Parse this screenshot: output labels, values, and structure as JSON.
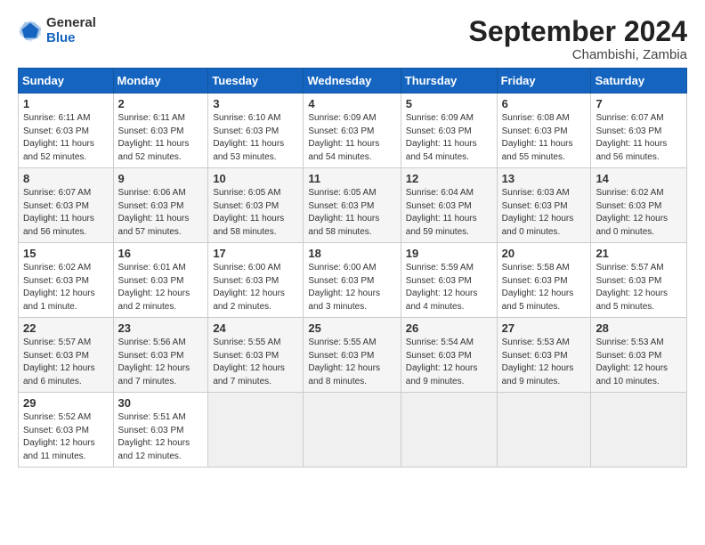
{
  "header": {
    "logo_general": "General",
    "logo_blue": "Blue",
    "month_title": "September 2024",
    "subtitle": "Chambishi, Zambia"
  },
  "weekdays": [
    "Sunday",
    "Monday",
    "Tuesday",
    "Wednesday",
    "Thursday",
    "Friday",
    "Saturday"
  ],
  "weeks": [
    [
      {
        "day": "1",
        "info": "Sunrise: 6:11 AM\nSunset: 6:03 PM\nDaylight: 11 hours\nand 52 minutes."
      },
      {
        "day": "2",
        "info": "Sunrise: 6:11 AM\nSunset: 6:03 PM\nDaylight: 11 hours\nand 52 minutes."
      },
      {
        "day": "3",
        "info": "Sunrise: 6:10 AM\nSunset: 6:03 PM\nDaylight: 11 hours\nand 53 minutes."
      },
      {
        "day": "4",
        "info": "Sunrise: 6:09 AM\nSunset: 6:03 PM\nDaylight: 11 hours\nand 54 minutes."
      },
      {
        "day": "5",
        "info": "Sunrise: 6:09 AM\nSunset: 6:03 PM\nDaylight: 11 hours\nand 54 minutes."
      },
      {
        "day": "6",
        "info": "Sunrise: 6:08 AM\nSunset: 6:03 PM\nDaylight: 11 hours\nand 55 minutes."
      },
      {
        "day": "7",
        "info": "Sunrise: 6:07 AM\nSunset: 6:03 PM\nDaylight: 11 hours\nand 56 minutes."
      }
    ],
    [
      {
        "day": "8",
        "info": "Sunrise: 6:07 AM\nSunset: 6:03 PM\nDaylight: 11 hours\nand 56 minutes."
      },
      {
        "day": "9",
        "info": "Sunrise: 6:06 AM\nSunset: 6:03 PM\nDaylight: 11 hours\nand 57 minutes."
      },
      {
        "day": "10",
        "info": "Sunrise: 6:05 AM\nSunset: 6:03 PM\nDaylight: 11 hours\nand 58 minutes."
      },
      {
        "day": "11",
        "info": "Sunrise: 6:05 AM\nSunset: 6:03 PM\nDaylight: 11 hours\nand 58 minutes."
      },
      {
        "day": "12",
        "info": "Sunrise: 6:04 AM\nSunset: 6:03 PM\nDaylight: 11 hours\nand 59 minutes."
      },
      {
        "day": "13",
        "info": "Sunrise: 6:03 AM\nSunset: 6:03 PM\nDaylight: 12 hours\nand 0 minutes."
      },
      {
        "day": "14",
        "info": "Sunrise: 6:02 AM\nSunset: 6:03 PM\nDaylight: 12 hours\nand 0 minutes."
      }
    ],
    [
      {
        "day": "15",
        "info": "Sunrise: 6:02 AM\nSunset: 6:03 PM\nDaylight: 12 hours\nand 1 minute."
      },
      {
        "day": "16",
        "info": "Sunrise: 6:01 AM\nSunset: 6:03 PM\nDaylight: 12 hours\nand 2 minutes."
      },
      {
        "day": "17",
        "info": "Sunrise: 6:00 AM\nSunset: 6:03 PM\nDaylight: 12 hours\nand 2 minutes."
      },
      {
        "day": "18",
        "info": "Sunrise: 6:00 AM\nSunset: 6:03 PM\nDaylight: 12 hours\nand 3 minutes."
      },
      {
        "day": "19",
        "info": "Sunrise: 5:59 AM\nSunset: 6:03 PM\nDaylight: 12 hours\nand 4 minutes."
      },
      {
        "day": "20",
        "info": "Sunrise: 5:58 AM\nSunset: 6:03 PM\nDaylight: 12 hours\nand 5 minutes."
      },
      {
        "day": "21",
        "info": "Sunrise: 5:57 AM\nSunset: 6:03 PM\nDaylight: 12 hours\nand 5 minutes."
      }
    ],
    [
      {
        "day": "22",
        "info": "Sunrise: 5:57 AM\nSunset: 6:03 PM\nDaylight: 12 hours\nand 6 minutes."
      },
      {
        "day": "23",
        "info": "Sunrise: 5:56 AM\nSunset: 6:03 PM\nDaylight: 12 hours\nand 7 minutes."
      },
      {
        "day": "24",
        "info": "Sunrise: 5:55 AM\nSunset: 6:03 PM\nDaylight: 12 hours\nand 7 minutes."
      },
      {
        "day": "25",
        "info": "Sunrise: 5:55 AM\nSunset: 6:03 PM\nDaylight: 12 hours\nand 8 minutes."
      },
      {
        "day": "26",
        "info": "Sunrise: 5:54 AM\nSunset: 6:03 PM\nDaylight: 12 hours\nand 9 minutes."
      },
      {
        "day": "27",
        "info": "Sunrise: 5:53 AM\nSunset: 6:03 PM\nDaylight: 12 hours\nand 9 minutes."
      },
      {
        "day": "28",
        "info": "Sunrise: 5:53 AM\nSunset: 6:03 PM\nDaylight: 12 hours\nand 10 minutes."
      }
    ],
    [
      {
        "day": "29",
        "info": "Sunrise: 5:52 AM\nSunset: 6:03 PM\nDaylight: 12 hours\nand 11 minutes."
      },
      {
        "day": "30",
        "info": "Sunrise: 5:51 AM\nSunset: 6:03 PM\nDaylight: 12 hours\nand 12 minutes."
      },
      {
        "day": "",
        "info": ""
      },
      {
        "day": "",
        "info": ""
      },
      {
        "day": "",
        "info": ""
      },
      {
        "day": "",
        "info": ""
      },
      {
        "day": "",
        "info": ""
      }
    ]
  ]
}
